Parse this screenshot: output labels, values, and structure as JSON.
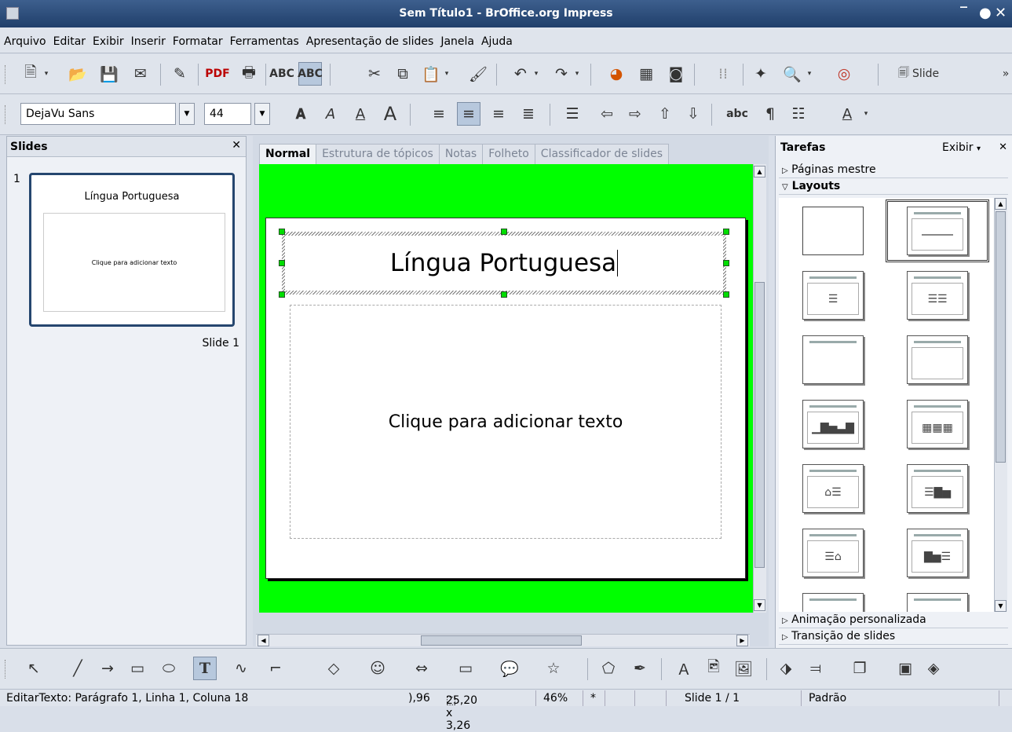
{
  "window": {
    "title": "Sem Título1 - BrOffice.org Impress"
  },
  "menu": [
    "Arquivo",
    "Editar",
    "Exibir",
    "Inserir",
    "Formatar",
    "Ferramentas",
    "Apresentação de slides",
    "Janela",
    "Ajuda"
  ],
  "toolbar1": {
    "icons": [
      "new-icon",
      "open-icon",
      "save-icon",
      "email-icon",
      "edit-file-icon",
      "export-pdf-icon",
      "print-icon",
      "spellcheck-icon",
      "autospell-icon",
      "cut-icon",
      "copy-icon",
      "paste-icon",
      "format-paintbrush-icon",
      "undo-icon",
      "redo-icon",
      "chart-icon",
      "table-icon",
      "image-icon",
      "grid-icon",
      "navigator-icon",
      "zoom-icon",
      "help-icon"
    ],
    "slide_label": "Slide"
  },
  "toolbar2": {
    "font_name": "DejaVu Sans",
    "font_size": "44"
  },
  "slides_pane": {
    "header": "Slides",
    "thumb_number": "1",
    "thumb_title": "Língua Portuguesa",
    "thumb_body": "Clique para adicionar texto",
    "thumb_caption": "Slide 1"
  },
  "view_tabs": [
    "Normal",
    "Estrutura de tópicos",
    "Notas",
    "Folheto",
    "Classificador de slides"
  ],
  "slide": {
    "title": "Língua Portuguesa",
    "body": "Clique para adicionar texto"
  },
  "task_pane": {
    "header": "Tarefas",
    "view_menu": "Exibir",
    "sections": {
      "master": "Páginas mestre",
      "layouts": "Layouts",
      "animation": "Animação personalizada",
      "transition": "Transição de slides"
    }
  },
  "status_bar": {
    "mode": "EditarTexto: Parágrafo 1, Linha 1, Coluna 18",
    "position": "),96",
    "size": "25,20 x 3,26",
    "zoom": "46%",
    "modified": "*",
    "slide": "Slide 1 / 1",
    "style": "Padrão"
  },
  "colors": {
    "titlebar": "#2c4c7c",
    "canvas_bg": "#00ff00",
    "selection_border": "#25466f"
  }
}
